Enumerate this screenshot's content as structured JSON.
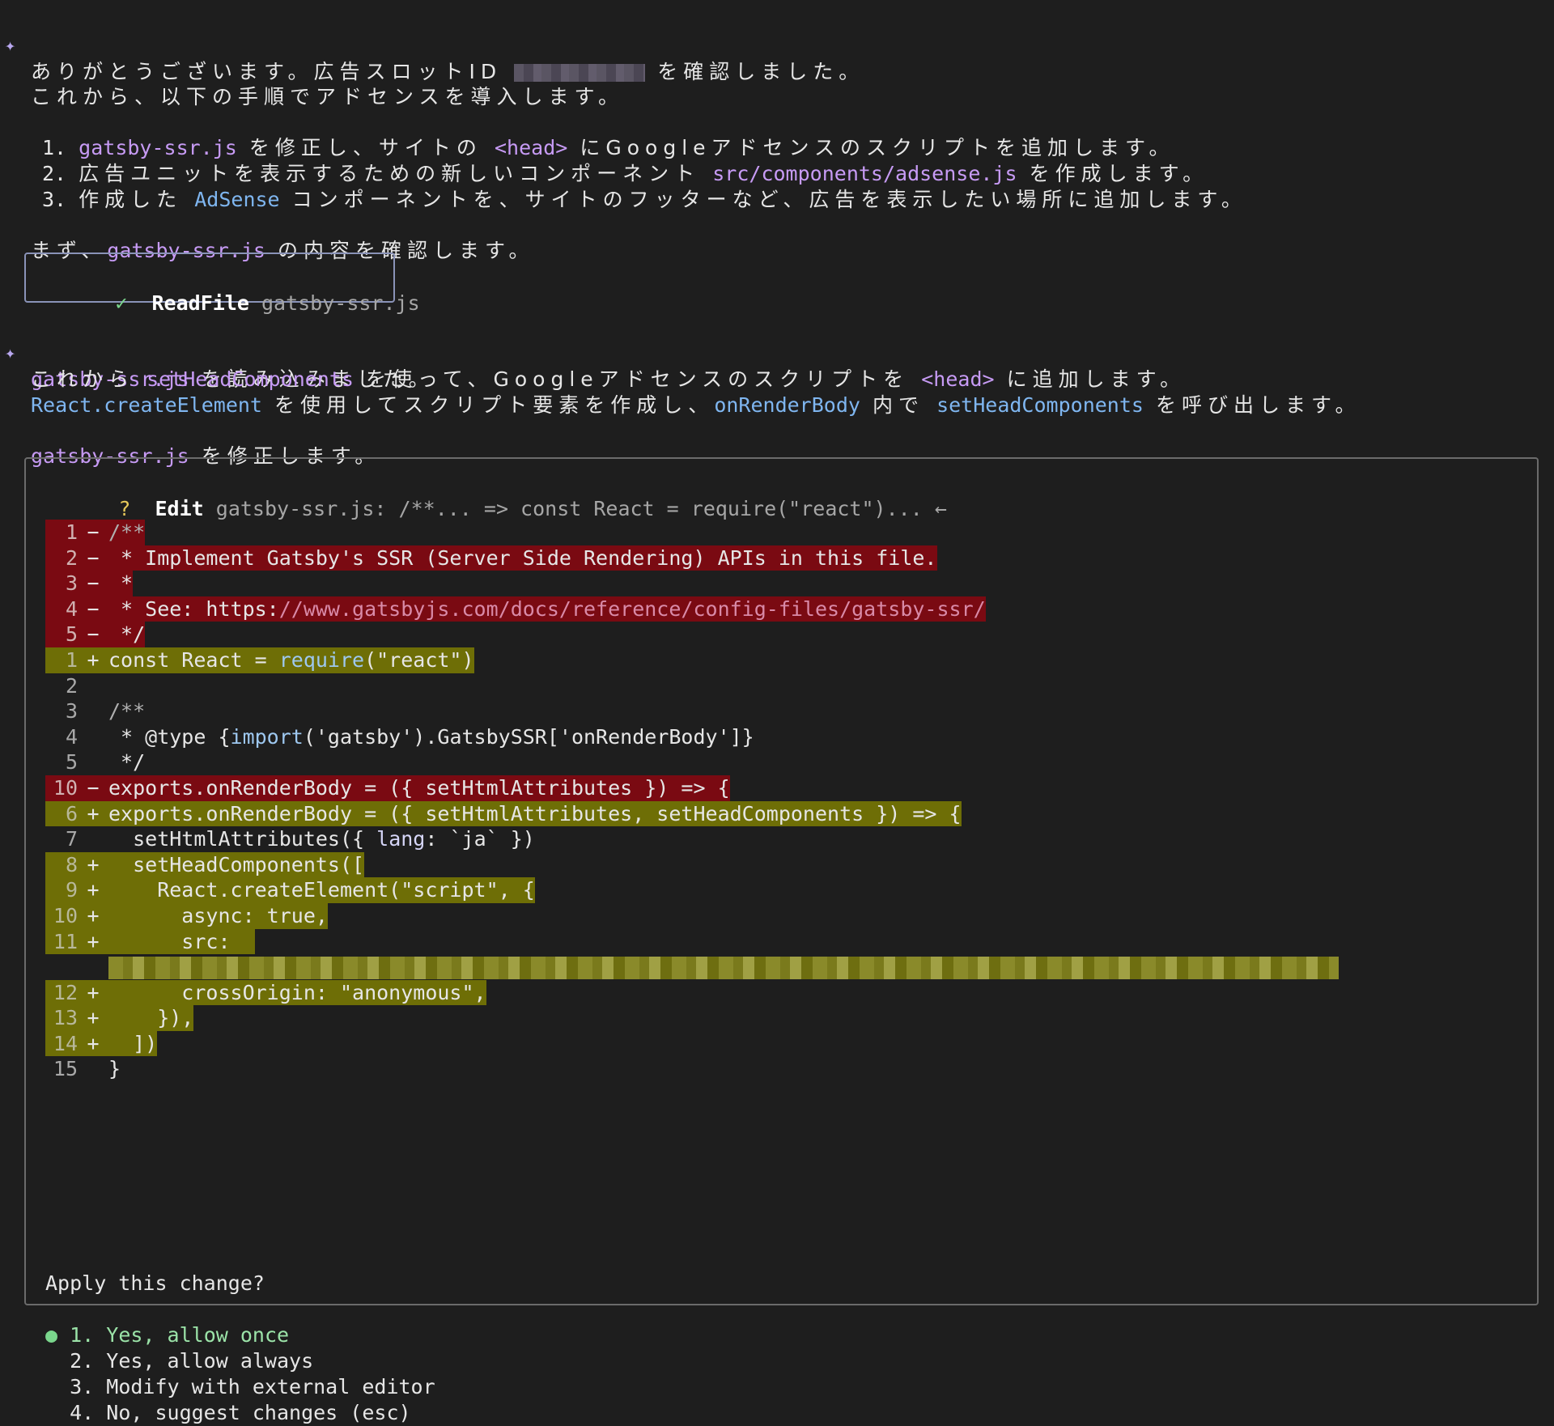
{
  "msg1": {
    "pre": "ありがとうございます。広告スロットID",
    "post": "を確認しました。"
  },
  "intro": "これから、以下の手順でアドセンスを導入します。",
  "steps": [
    {
      "num": "1.",
      "code": "gatsby-ssr.js",
      "text_a": "を修正し、サイトの",
      "code2": "<head>",
      "text_b": "にGoogleアドセンスのスクリプトを追加します。"
    },
    {
      "num": "2.",
      "text_a": "広告ユニットを表示するための新しいコンポーネント",
      "code": "src/components/adsense.js",
      "text_b": "を作成します。"
    },
    {
      "num": "3.",
      "text_a": "作成した",
      "code": "AdSense",
      "text_b": "コンポーネントを、サイトのフッターなど、広告を表示したい場所に追加します。"
    }
  ],
  "first": {
    "pre": "まず、",
    "code": "gatsby-ssr.js",
    "post": "の内容を確認します。"
  },
  "readfile": {
    "icon": "check-icon",
    "label": "ReadFile",
    "file": "gatsby-ssr.js"
  },
  "msg2": {
    "l1_code": "gatsby-ssr.js",
    "l1_text": "を読み込みました。",
    "l2_pre": "これから",
    "l2_code": "setHeadComponents",
    "l2_mid": "を使って、Googleアドセンスのスクリプトを",
    "l2_code2": "<head>",
    "l2_post": "に追加します。",
    "l3_code": "React.createElement",
    "l3_mid": "を使用してスクリプト要素を作成し、",
    "l3_code2": "onRenderBody",
    "l3_mid2": "内で",
    "l3_code3": "setHeadComponents",
    "l3_post": "を呼び出します。"
  },
  "modify": {
    "code": "gatsby-ssr.js",
    "text": "を修正します。"
  },
  "edit": {
    "q": "?",
    "label": "Edit",
    "desc": "gatsby-ssr.js: /**... => const React = require(\"react\")... ←"
  },
  "diff": {
    "d1": {
      "n": "1",
      "s": "−",
      "c": "/**"
    },
    "d2": {
      "n": "2",
      "s": "−",
      "c": " * Implement Gatsby's SSR (Server Side Rendering) APIs in this file."
    },
    "d3": {
      "n": "3",
      "s": "−",
      "c": " *"
    },
    "d4": {
      "n": "4",
      "s": "−",
      "c1": " * See: https:",
      "c2": "//www.gatsbyjs.com/docs/reference/config-files/gatsby-ssr/"
    },
    "d5": {
      "n": "5",
      "s": "−",
      "c": " */"
    },
    "a1": {
      "n": "1",
      "s": "+",
      "c1": "const React = ",
      "c2": "require",
      "c3": "(\"react\")"
    },
    "c2": {
      "n": "2",
      "s": " ",
      "c": ""
    },
    "c3": {
      "n": "3",
      "s": " ",
      "c": "/**"
    },
    "c4": {
      "n": "4",
      "s": " ",
      "c1": " * @type {",
      "c2": "import",
      "c3": "('gatsby').GatsbySSR['onRenderBody']}"
    },
    "c5": {
      "n": "5",
      "s": " ",
      "c": " */"
    },
    "d10": {
      "n": "10",
      "s": "−",
      "c": "exports.onRenderBody = ({ setHtmlAttributes }) => {"
    },
    "a6": {
      "n": "6",
      "s": "+",
      "c": "exports.onRenderBody = ({ setHtmlAttributes, setHeadComponents }) => {"
    },
    "c7": {
      "n": "7",
      "s": " ",
      "c1": "  setHtmlAttributes({ ",
      "c2": "lang",
      "c3": ": `ja` })"
    },
    "a8": {
      "n": "8",
      "s": "+",
      "c": "  setHeadComponents(["
    },
    "a9": {
      "n": "9",
      "s": "+",
      "c": "    React.createElement(\"script\", {"
    },
    "a10": {
      "n": "10",
      "s": "+",
      "c": "      async: true,"
    },
    "a11": {
      "n": "11",
      "s": "+",
      "c": "      src:"
    },
    "a12": {
      "n": "12",
      "s": "+",
      "c": "      crossOrigin: \"anonymous\","
    },
    "a13": {
      "n": "13",
      "s": "+",
      "c": "    }),"
    },
    "a14": {
      "n": "14",
      "s": "+",
      "c": "  ])"
    },
    "c15": {
      "n": "15",
      "s": " ",
      "c": "}"
    }
  },
  "apply": "Apply this change?",
  "options": [
    {
      "bullet": "●",
      "label": "1. Yes, allow once"
    },
    {
      "label": "2. Yes, allow always"
    },
    {
      "label": "3. Modify with external editor"
    },
    {
      "label": "4. No, suggest changes (esc)"
    }
  ]
}
